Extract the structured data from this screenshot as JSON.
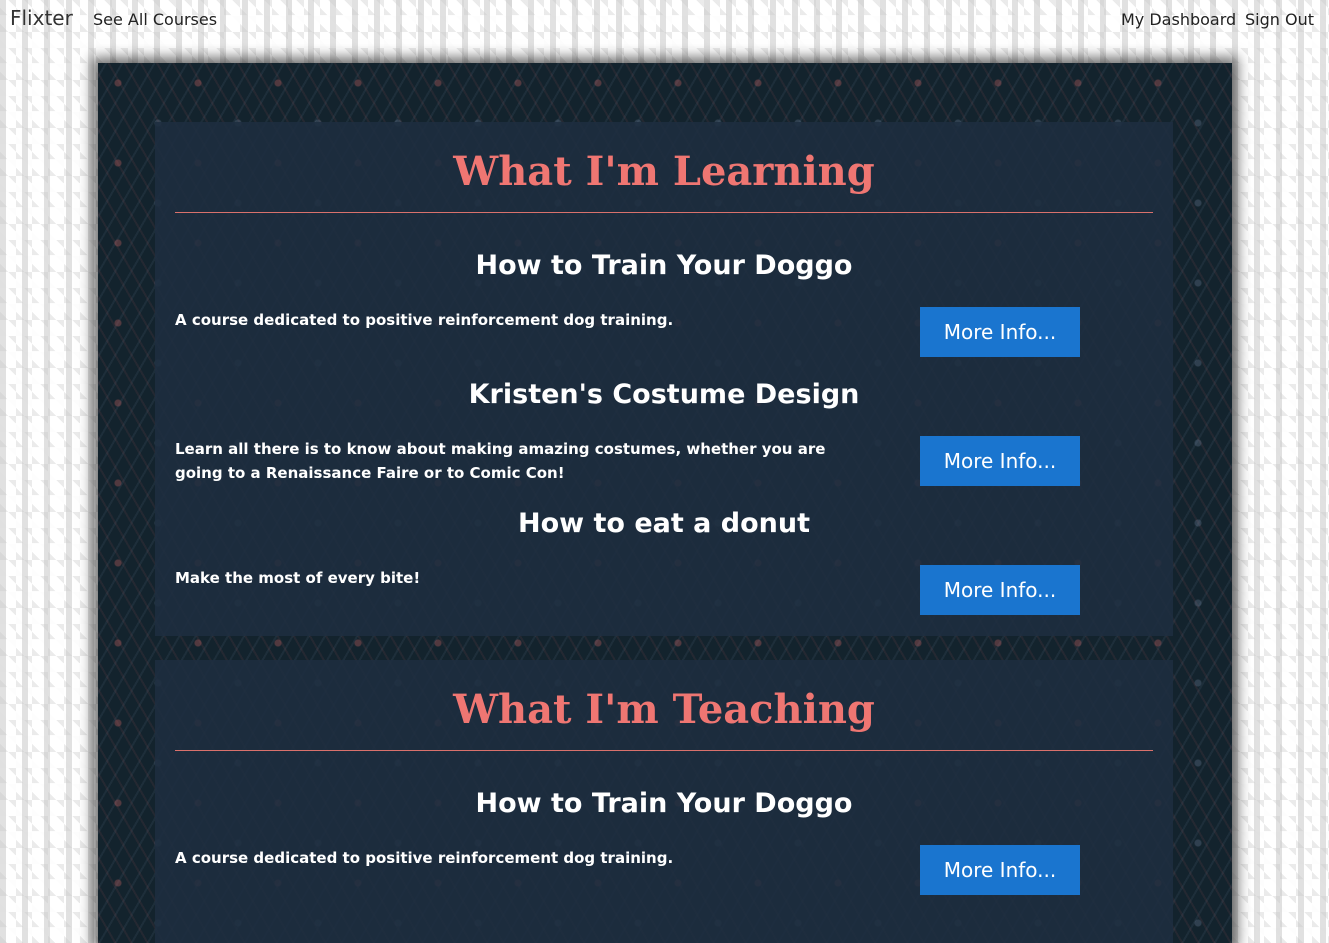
{
  "nav": {
    "brand": "Flixter",
    "see_all": "See All Courses",
    "dashboard": "My Dashboard",
    "sign_out": "Sign Out"
  },
  "learning": {
    "title": "What I'm Learning",
    "courses": [
      {
        "title": "How to Train Your Doggo",
        "description": "A course dedicated to positive reinforcement dog training.",
        "button": "More Info..."
      },
      {
        "title": "Kristen's Costume Design",
        "description": "Learn all there is to know about making amazing costumes, whether you are going to a Renaissance Faire or to Comic Con!",
        "button": "More Info..."
      },
      {
        "title": "How to eat a donut",
        "description": "Make the most of every bite!",
        "button": "More Info..."
      }
    ]
  },
  "teaching": {
    "title": "What I'm Teaching",
    "courses": [
      {
        "title": "How to Train Your Doggo",
        "description": "A course dedicated to positive reinforcement dog training.",
        "button": "More Info..."
      }
    ]
  },
  "colors": {
    "accent": "#ef7672",
    "button": "#1a75cf",
    "frame": "#13232d",
    "panel": "#1e2e40"
  }
}
